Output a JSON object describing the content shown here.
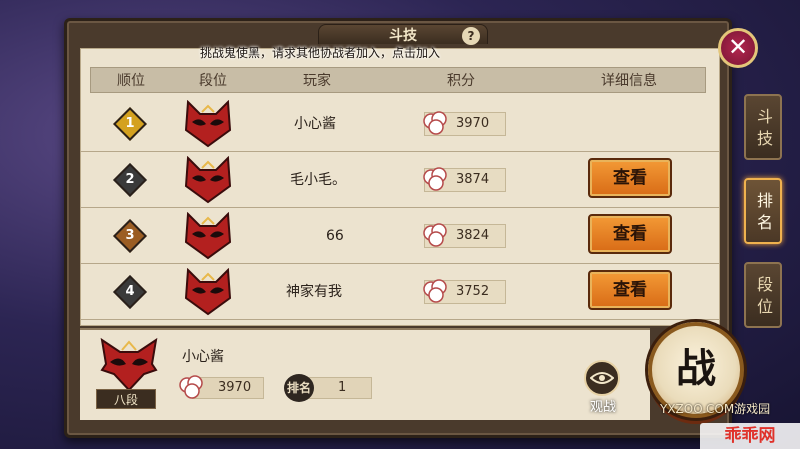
{
  "title": "斗技",
  "help": "?",
  "notice": "挑战鬼使黑，请求其他协战者加入，点击加入",
  "close": "✕",
  "header": {
    "rank": "顺位",
    "tier": "段位",
    "player": "玩家",
    "score": "积分",
    "details": "详细信息"
  },
  "rows": [
    {
      "rank": "1",
      "player": "小心酱",
      "score": "3970",
      "view": "",
      "color": "#d4a11f"
    },
    {
      "rank": "2",
      "player": "毛小毛。",
      "score": "3874",
      "view": "查看",
      "color": "#3a3a3a"
    },
    {
      "rank": "3",
      "player": "66",
      "score": "3824",
      "view": "查看",
      "color": "#9b5d23"
    },
    {
      "rank": "4",
      "player": "神家有我",
      "score": "3752",
      "view": "查看",
      "color": "#3a3a3a"
    }
  ],
  "self": {
    "name": "小心酱",
    "tier": "八段",
    "score": "3970",
    "rank_label": "排名",
    "rank": "1"
  },
  "watch": "观战",
  "fight": "战",
  "side_tabs": [
    "斗技",
    "排名",
    "段位"
  ],
  "watermark_site": "YXZOO.COM游戏园",
  "watermark_brand": "乖乖网"
}
